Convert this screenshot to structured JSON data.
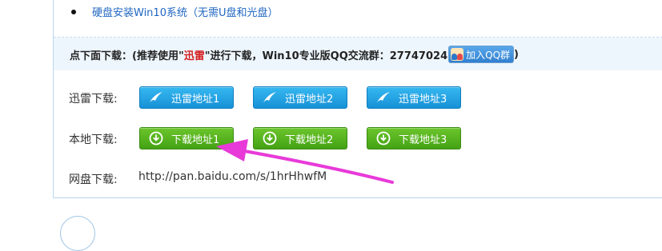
{
  "related": {
    "link_text": "硬盘安装Win10系统（无需U盘和光盘）"
  },
  "notice": {
    "prefix": "点下面下载：(推荐使用\"",
    "highlight": "迅雷",
    "suffix": "\"进行下载，Win10专业版QQ交流群：27747024",
    "qq_button": "加入QQ群",
    "close_paren": ")"
  },
  "rows": {
    "thunder_label": "迅雷下载:",
    "local_label": "本地下载:",
    "netdisk_label": "网盘下载:"
  },
  "thunder_buttons": [
    "迅雷地址1",
    "迅雷地址2",
    "迅雷地址3"
  ],
  "local_buttons": [
    "下载地址1",
    "下载地址2",
    "下载地址3"
  ],
  "netdisk_url": "http://pan.baidu.com/s/1hrHhwfM",
  "colors": {
    "link": "#1f66c2",
    "highlight": "#d42020",
    "blue_button": "#1791d6",
    "green_button": "#44a214",
    "arrow": "#e83ad9"
  },
  "icons": {
    "thunder": "thunder-bird-icon",
    "download": "download-circle-icon",
    "qq": "qq-group-icon"
  }
}
